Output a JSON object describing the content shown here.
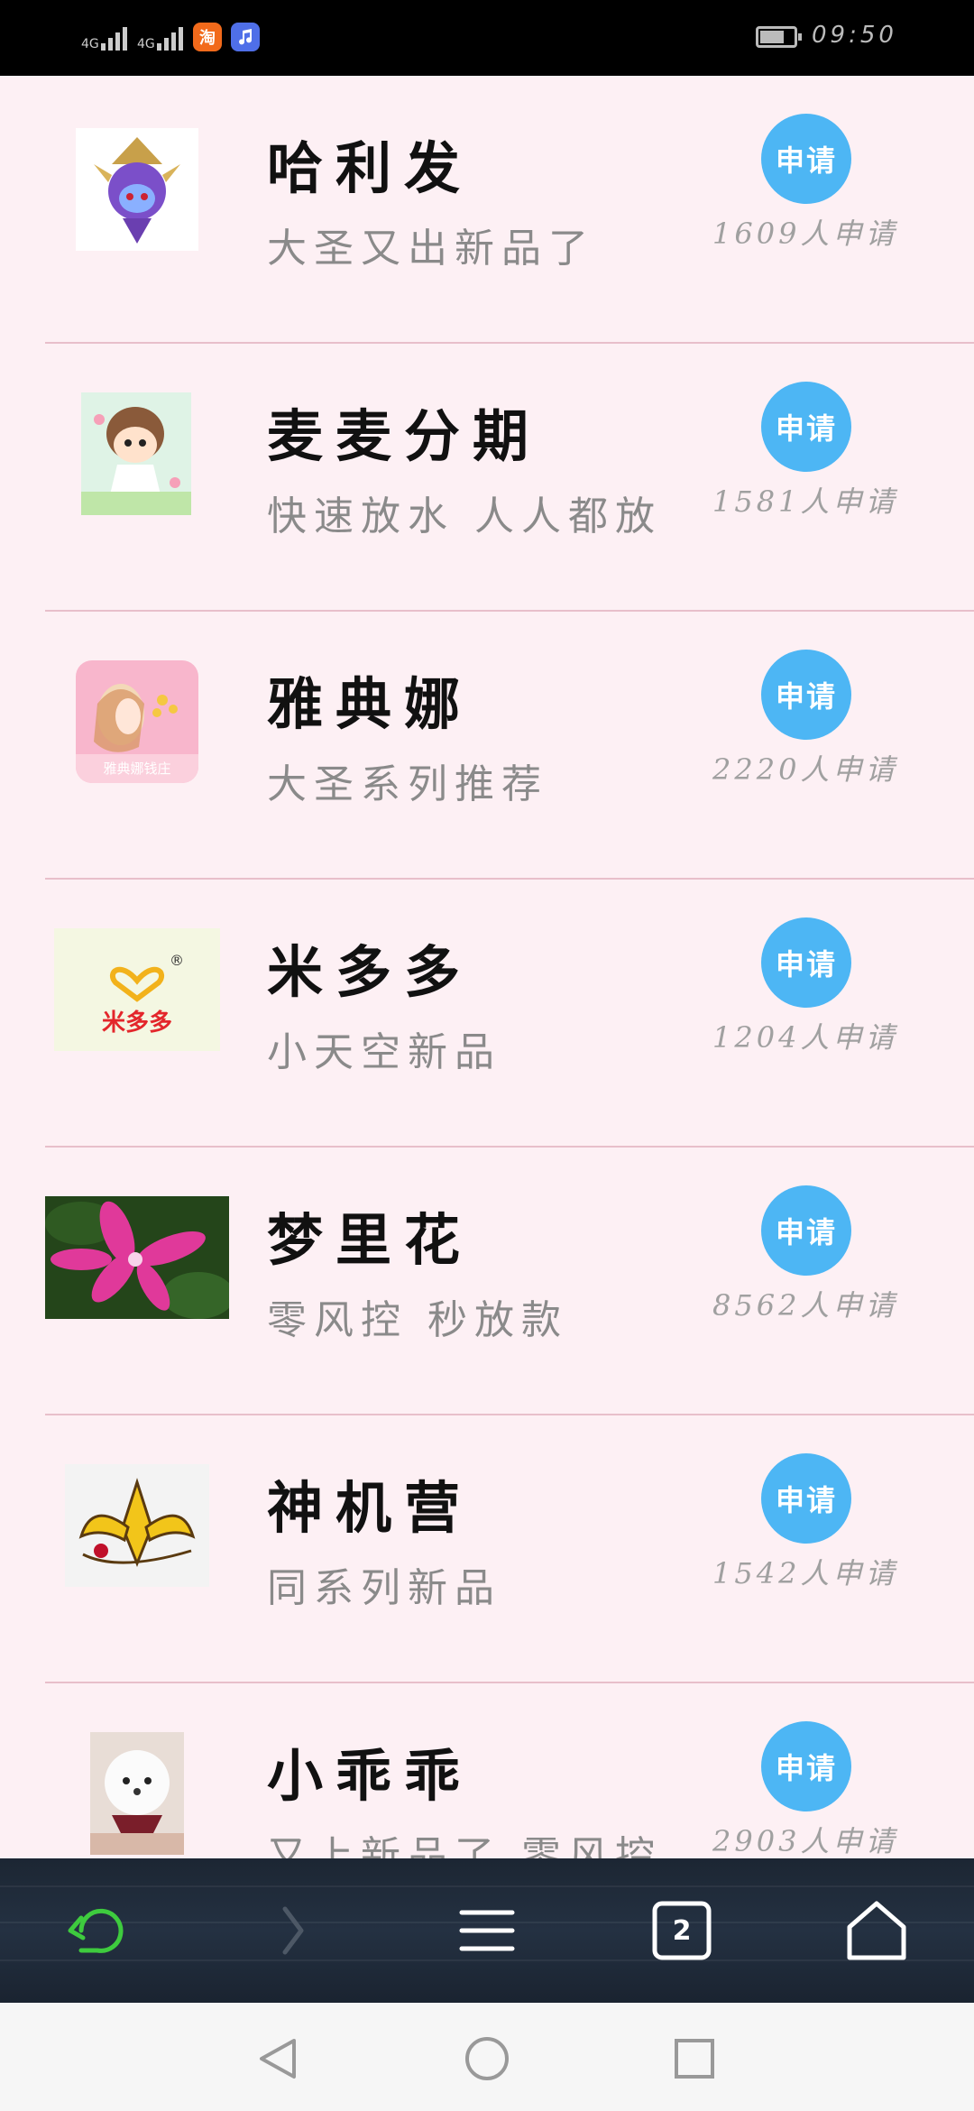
{
  "status_bar": {
    "signal1_label": "4G",
    "signal2_label": "4G",
    "taobao_icon_text": "淘",
    "time": "09:50"
  },
  "items": [
    {
      "name": "哈利发",
      "subtitle": "大圣又出新品了",
      "button": "申请",
      "count": "1609人申请"
    },
    {
      "name": "麦麦分期",
      "subtitle": "快速放水  人人都放",
      "button": "申请",
      "count": "1581人申请"
    },
    {
      "name": "雅典娜",
      "subtitle": "大圣系列推荐",
      "button": "申请",
      "count": "2220人申请",
      "logo_text": "雅典娜钱庄"
    },
    {
      "name": "米多多",
      "subtitle": "小天空新品",
      "button": "申请",
      "count": "1204人申请",
      "logo_text": "米多多",
      "logo_mark": "®"
    },
    {
      "name": "梦里花",
      "subtitle": "零风控  秒放款",
      "button": "申请",
      "count": "8562人申请"
    },
    {
      "name": "神机营",
      "subtitle": "同系列新品",
      "button": "申请",
      "count": "1542人申请"
    },
    {
      "name": "小乖乖",
      "subtitle": "又上新品了  零风控",
      "button": "申请",
      "count": "2903人申请"
    }
  ],
  "browser_bar": {
    "tab_count": "2"
  },
  "colors": {
    "page_bg": "#fdf0f4",
    "button": "#4db6f4",
    "divider": "#e8bfca",
    "back_icon": "#3ecb3e"
  }
}
